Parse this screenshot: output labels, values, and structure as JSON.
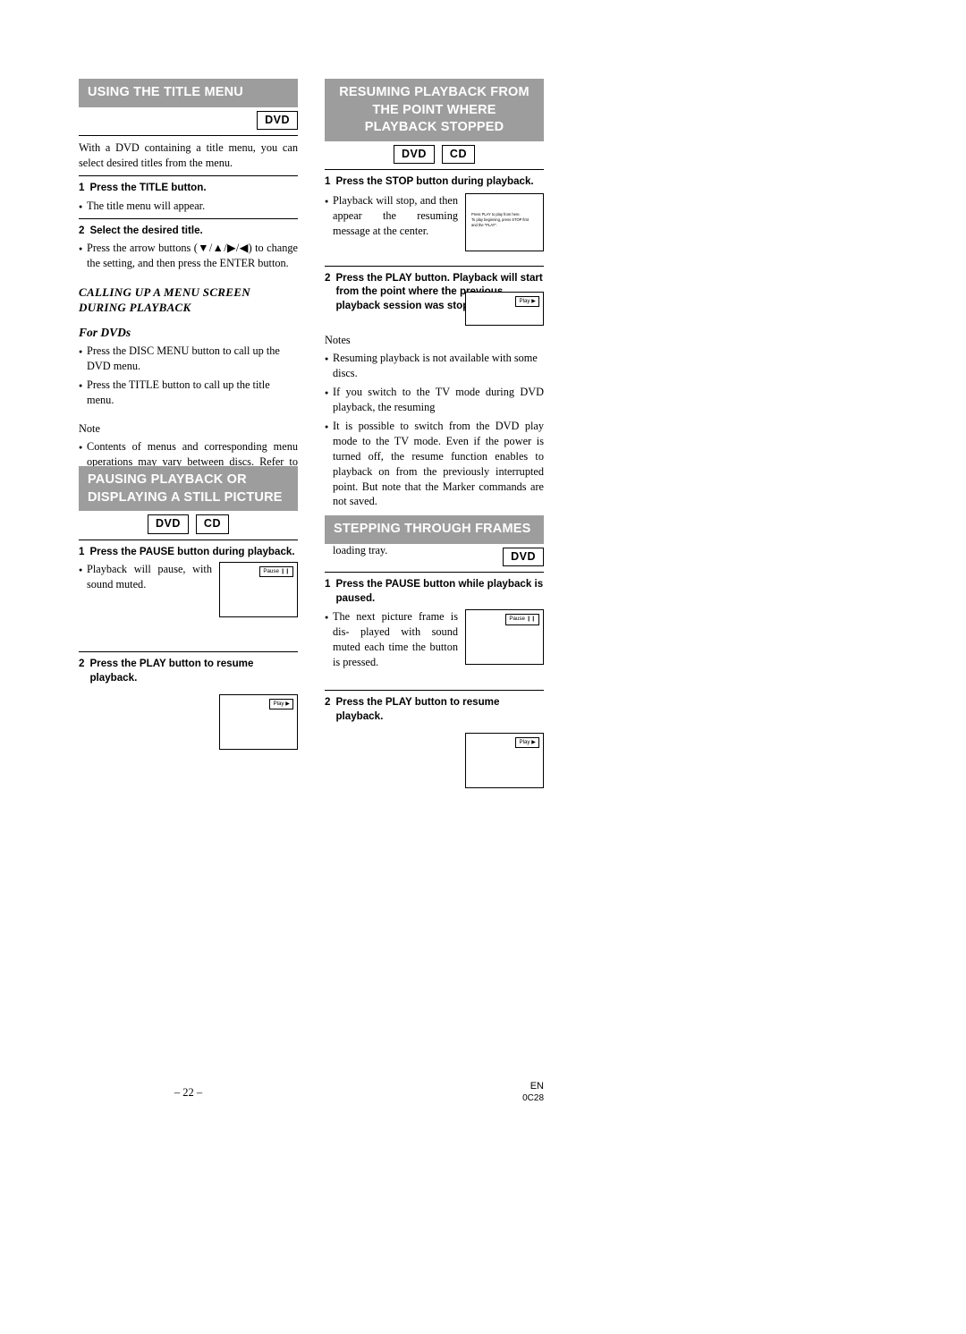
{
  "page": {
    "number": "– 22 –",
    "lang": "EN",
    "code": "0C28"
  },
  "badges": {
    "dvd": "DVD",
    "cd": "CD"
  },
  "sections": {
    "title_menu": {
      "heading": "USING THE TITLE MENU",
      "intro": "With a DVD containing a title menu, you can select desired titles from the menu.",
      "step1_num": "1",
      "step1": "Press the TITLE button.",
      "bullet1": "The title menu will appear.",
      "step2_num": "2",
      "step2": "Select the desired title.",
      "bullet2": "Press the arrow buttons (▼/▲/▶/◀) to change the setting, and then press the ENTER button."
    },
    "menu_screen": {
      "subhead_l1": "CALLING UP A MENU SCREEN",
      "subhead_l2": "DURING PLAYBACK",
      "fordvds": "For DVDs",
      "bullet1": "Press the DISC MENU button to call up the DVD menu.",
      "bullet2": "Press the TITLE button to call up the title menu.",
      "note_label": "Note",
      "note1": "Contents of menus and corresponding menu operations may vary between discs. Refer to the manual accompanying the disc for details."
    },
    "pausing": {
      "heading_l1": "PAUSING PLAYBACK OR",
      "heading_l2": "DISPLAYING A STILL PICTURE",
      "step1_num": "1",
      "step1": "Press the PAUSE button during playback.",
      "bullet1": "Playback will pause, with sound muted.",
      "tv1_button": "Pause ❙❙",
      "step2_num": "2",
      "step2": "Press the PLAY button to resume playback.",
      "tv2_button": "Play ▶"
    },
    "resuming": {
      "heading_l1": "RESUMING PLAYBACK FROM",
      "heading_l2": "THE POINT WHERE",
      "heading_l3": "PLAYBACK STOPPED",
      "step1_num": "1",
      "step1": "Press the STOP button during playback.",
      "bullet1": "Playback will stop, and then appear the resuming message at the center.",
      "tv1_msg": "Press PLAY to play from here.\nTo play beginning, press STOP first\nand the \"PLAY\".",
      "step2_num": "2",
      "step2": "Press the PLAY button. Playback will start from the point where the previous playback session was stopped.",
      "tv2_button": "Play ▶",
      "notes_label": "Notes",
      "note1": "Resuming playback is not available with some discs.",
      "note2": "If you switch to the TV mode during DVD playback, the resuming",
      "note3": "It is possible to switch from the DVD play mode to the TV mode. Even if the power is turned off, the resume function enables to playback on from the previously interrupted point. But note that the Marker commands are not saved.",
      "note4": "The resume function can be reset by pressing the STOP button twice or by opening the disc loading tray."
    },
    "stepping": {
      "heading": "STEPPING THROUGH FRAMES",
      "step1_num": "1",
      "step1": "Press the PAUSE button while playback is paused.",
      "bullet1": "The next picture frame is dis- played with sound muted each time the button is pressed.",
      "tv1_button": "Pause ❙❙",
      "step2_num": "2",
      "step2": "Press the PLAY button to resume playback.",
      "tv2_button": "Play ▶"
    }
  }
}
